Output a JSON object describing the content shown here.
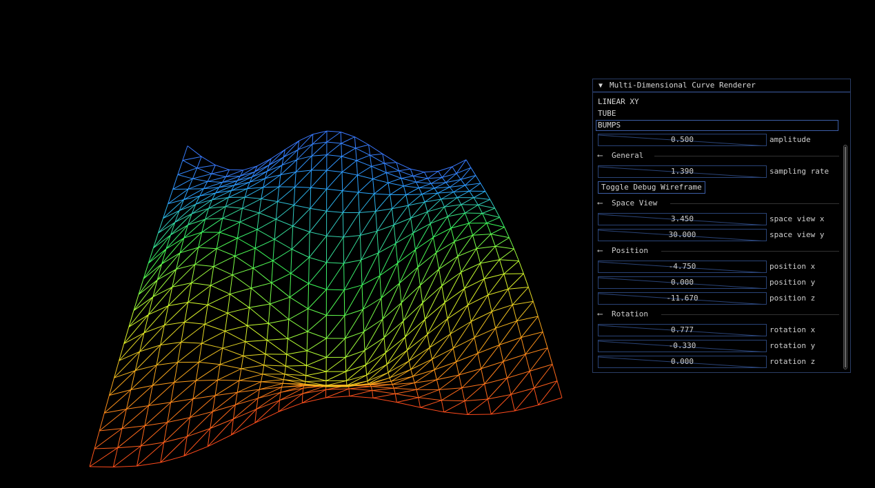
{
  "panel": {
    "title": "Multi-Dimensional Curve Renderer",
    "collapse_icon": "triangle-down-icon",
    "accent_color": "#3d5fa8",
    "list_items": [
      "LINEAR XY",
      "TUBE",
      "BUMPS"
    ],
    "selected_index": 2,
    "amplitude": {
      "value": "0.500",
      "label": "amplitude",
      "fraction": 0.5
    },
    "general": {
      "header": "General"
    },
    "sampling_rate": {
      "value": "1.390",
      "label": "sampling rate",
      "fraction": 0.4
    },
    "debug_button": "Toggle Debug Wireframe",
    "space_view": {
      "header": "Space View",
      "x": {
        "value": "3.450",
        "label": "space view x",
        "fraction": 0.35
      },
      "y": {
        "value": "30.000",
        "label": "space view y",
        "fraction": 0.6
      }
    },
    "position": {
      "header": "Position",
      "x": {
        "value": "-4.750",
        "label": "position x",
        "fraction": 0.4
      },
      "y": {
        "value": "0.000",
        "label": "position y",
        "fraction": 0.5
      },
      "z": {
        "value": "-11.670",
        "label": "position z",
        "fraction": 0.3
      }
    },
    "rotation": {
      "header": "Rotation",
      "x": {
        "value": "0.777",
        "label": "rotation x",
        "fraction": 0.55
      },
      "y": {
        "value": "-0.330",
        "label": "rotation y",
        "fraction": 0.45
      },
      "z": {
        "value": "0.000",
        "label": "rotation z",
        "fraction": 0.5
      }
    }
  },
  "mesh": {
    "colormap": [
      "#ff4a1c",
      "#ff9c1a",
      "#d8ff2a",
      "#3cff5a",
      "#2aa8ff",
      "#3a78ff"
    ]
  }
}
